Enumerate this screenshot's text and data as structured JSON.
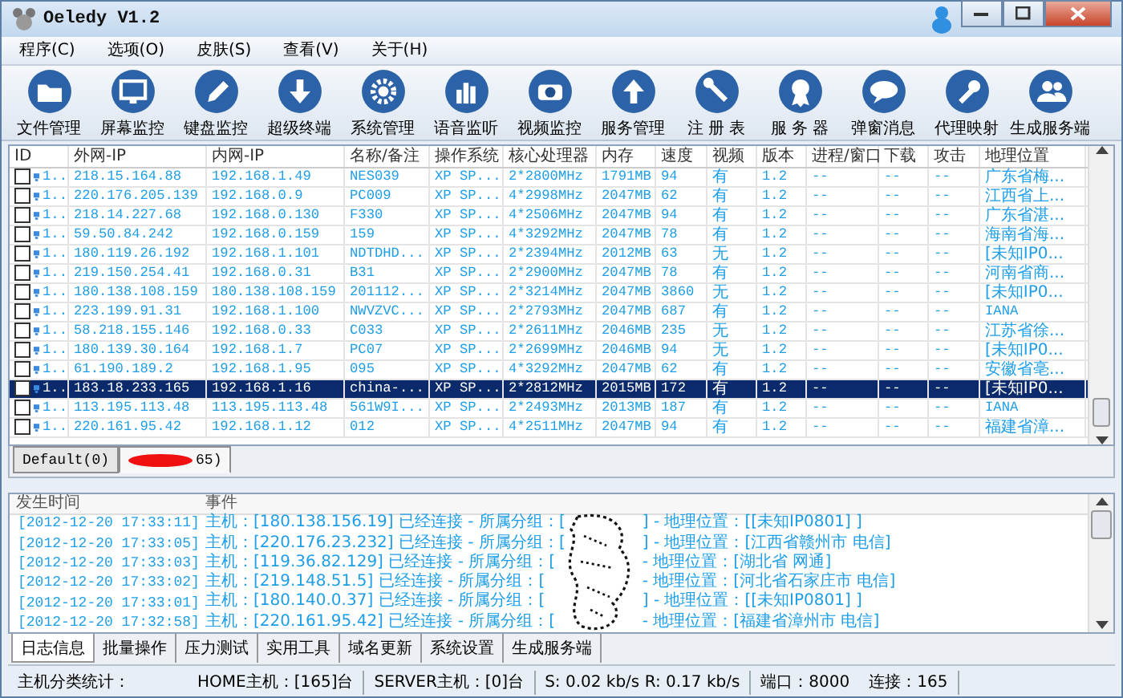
{
  "window": {
    "title": "Oeledy V1.2"
  },
  "menu": [
    "程序(C)",
    "选项(O)",
    "皮肤(S)",
    "查看(V)",
    "关于(H)"
  ],
  "toolbar": [
    "文件管理",
    "屏幕监控",
    "键盘监控",
    "超级终端",
    "系统管理",
    "语音监听",
    "视频监控",
    "服务管理",
    "注 册 表",
    "服 务 器",
    "弹窗消息",
    "代理映射",
    "生成服务端"
  ],
  "table": {
    "columns": [
      "ID",
      "外网-IP",
      "内网-IP",
      "名称/备注",
      "操作系统",
      "核心处理器",
      "内存",
      "速度",
      "视频",
      "版本",
      "进程/窗口",
      "下载",
      "攻击",
      "地理位置"
    ],
    "rows": [
      {
        "checked": false,
        "selected": false,
        "cells": [
          "1..",
          "218.15.164.88",
          "192.168.1.49",
          "NES039",
          "XP SP...",
          "2*2800MHz",
          "1791MB",
          "94",
          "有",
          "1.2",
          "--",
          "--",
          "--",
          "广东省梅..."
        ]
      },
      {
        "checked": false,
        "selected": false,
        "cells": [
          "1..",
          "220.176.205.139",
          "192.168.0.9",
          "PC009",
          "XP SP...",
          "4*2998MHz",
          "2047MB",
          "62",
          "有",
          "1.2",
          "--",
          "--",
          "--",
          "江西省上..."
        ]
      },
      {
        "checked": false,
        "selected": false,
        "cells": [
          "1..",
          "218.14.227.68",
          "192.168.0.130",
          "F330",
          "XP SP...",
          "4*2506MHz",
          "2047MB",
          "94",
          "有",
          "1.2",
          "--",
          "--",
          "--",
          "广东省湛..."
        ]
      },
      {
        "checked": false,
        "selected": false,
        "cells": [
          "1..",
          "59.50.84.242",
          "192.168.0.159",
          "159",
          "XP SP...",
          "4*3292MHz",
          "2047MB",
          "78",
          "有",
          "1.2",
          "--",
          "--",
          "--",
          "海南省海..."
        ]
      },
      {
        "checked": false,
        "selected": false,
        "cells": [
          "1..",
          "180.119.26.192",
          "192.168.1.101",
          "NDTDHD...",
          "XP SP...",
          "2*2394MHz",
          "2012MB",
          "63",
          "无",
          "1.2",
          "--",
          "--",
          "--",
          "[未知IP0..."
        ]
      },
      {
        "checked": false,
        "selected": false,
        "cells": [
          "1..",
          "219.150.254.41",
          "192.168.0.31",
          "B31",
          "XP SP...",
          "2*2900MHz",
          "2047MB",
          "78",
          "有",
          "1.2",
          "--",
          "--",
          "--",
          "河南省商..."
        ]
      },
      {
        "checked": false,
        "selected": false,
        "cells": [
          "1..",
          "180.138.108.159",
          "180.138.108.159",
          "201112...",
          "XP SP...",
          "2*3214MHz",
          "2047MB",
          "3860",
          "无",
          "1.2",
          "--",
          "--",
          "--",
          "[未知IP0..."
        ]
      },
      {
        "checked": false,
        "selected": false,
        "cells": [
          "1..",
          "223.199.91.31",
          "192.168.1.100",
          "NWVZVC...",
          "XP SP...",
          "2*2793MHz",
          "2047MB",
          "687",
          "有",
          "1.2",
          "--",
          "--",
          "--",
          "IANA"
        ]
      },
      {
        "checked": false,
        "selected": false,
        "cells": [
          "1..",
          "58.218.155.146",
          "192.168.0.33",
          "C033",
          "XP SP...",
          "2*2611MHz",
          "2046MB",
          "235",
          "无",
          "1.2",
          "--",
          "--",
          "--",
          "江苏省徐..."
        ]
      },
      {
        "checked": false,
        "selected": false,
        "cells": [
          "1..",
          "180.139.30.164",
          "192.168.1.7",
          "PC07",
          "XP SP...",
          "2*2699MHz",
          "2046MB",
          "94",
          "无",
          "1.2",
          "--",
          "--",
          "--",
          "[未知IP0..."
        ]
      },
      {
        "checked": false,
        "selected": false,
        "cells": [
          "1..",
          "61.190.189.2",
          "192.168.1.95",
          "095",
          "XP SP...",
          "4*3292MHz",
          "2047MB",
          "62",
          "有",
          "1.2",
          "--",
          "--",
          "--",
          "安徽省亳..."
        ]
      },
      {
        "checked": false,
        "selected": true,
        "cells": [
          "1..",
          "183.18.233.165",
          "192.168.1.16",
          "china-...",
          "XP SP...",
          "2*2812MHz",
          "2015MB",
          "172",
          "有",
          "1.2",
          "--",
          "--",
          "--",
          "[未知IP0..."
        ]
      },
      {
        "checked": false,
        "selected": false,
        "cells": [
          "1..",
          "113.195.113.48",
          "113.195.113.48",
          "561W9I...",
          "XP SP...",
          "2*2493MHz",
          "2013MB",
          "187",
          "有",
          "1.2",
          "--",
          "--",
          "--",
          "IANA"
        ]
      },
      {
        "checked": false,
        "selected": false,
        "cells": [
          "1..",
          "220.161.95.42",
          "192.168.1.12",
          "012",
          "XP SP...",
          "4*2511MHz",
          "2047MB",
          "94",
          "有",
          "1.2",
          "--",
          "--",
          "--",
          "福建省漳..."
        ]
      }
    ]
  },
  "group_tabs": [
    {
      "label": "Default(0)",
      "selected": false,
      "redacted": false
    },
    {
      "label": "65)",
      "selected": true,
      "redacted": true
    }
  ],
  "log": {
    "columns": [
      "发生时间",
      "事件"
    ],
    "rows": [
      {
        "time": "[2012-12-20 17:33:11]",
        "event_start": "主机：[180.138.156.19] 已经连接 - 所属分组：[",
        "event_end": "] - 地理位置：[[未知IP0801] ]"
      },
      {
        "time": "[2012-12-20 17:33:05]",
        "event_start": "主机：[220.176.23.232] 已经连接 - 所属分组：[",
        "event_end": "] - 地理位置：[江西省赣州市 电信]"
      },
      {
        "time": "[2012-12-20 17:33:03]",
        "event_start": "主机：[119.36.82.129] 已经连接 - 所属分组：[",
        "event_end": "- 地理位置：[湖北省 网通]"
      },
      {
        "time": "[2012-12-20 17:33:02]",
        "event_start": "主机：[219.148.51.5] 已经连接 - 所属分组：[",
        "event_end": "- 地理位置：[河北省石家庄市 电信]"
      },
      {
        "time": "[2012-12-20 17:33:01]",
        "event_start": "主机：[180.140.0.37] 已经连接 - 所属分组：[",
        "event_end": "] - 地理位置：[[未知IP0801] ]"
      },
      {
        "time": "[2012-12-20 17:32:58]",
        "event_start": "主机：[220.161.95.42] 已经连接 - 所属分组：[",
        "event_end": "- 地理位置：[福建省漳州市 电信]"
      }
    ]
  },
  "bottom_tabs": [
    {
      "label": "日志信息",
      "selected": true
    },
    {
      "label": "批量操作",
      "selected": false
    },
    {
      "label": "压力测试",
      "selected": false
    },
    {
      "label": "实用工具",
      "selected": false
    },
    {
      "label": "域名更新",
      "selected": false
    },
    {
      "label": "系统设置",
      "selected": false
    },
    {
      "label": "生成服务端",
      "selected": false
    }
  ],
  "status_bar": [
    "主机分类统计：",
    "HOME主机：[165]台",
    "SERVER主机：[0]台",
    "S: 0.02 kb/s R: 0.17 kb/s",
    "端口：8000",
    "连接：165"
  ]
}
